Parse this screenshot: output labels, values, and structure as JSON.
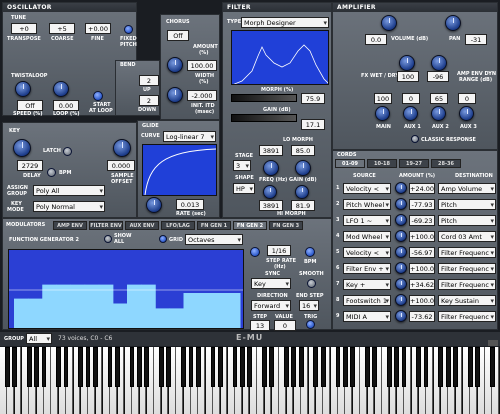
{
  "osc": {
    "title": "OSCILLATOR",
    "tune": "TUNE",
    "transpose": "+0",
    "coarse": "+5",
    "fine": "+0.00",
    "transpose_lbl": "TRANSPOSE",
    "coarse_lbl": "COARSE",
    "fine_lbl": "FINE",
    "fixed": "FIXED",
    "pitch": "PITCH",
    "twist": "TWISTALOOP",
    "speed": "Off",
    "loop": "0.00",
    "speed_lbl": "SPEED (%)",
    "loop_lbl": "LOOP (%)",
    "start": "START",
    "atloop": "AT LOOP"
  },
  "bend": {
    "title": "BEND",
    "up": "2",
    "up_lbl": "UP",
    "down": "2",
    "down_lbl": "DOWN"
  },
  "chorus": {
    "title": "CHORUS",
    "amount": "Off",
    "amount_lbl": "AMOUNT",
    "pct": "(%)",
    "width": "100.00",
    "width_lbl": "WIDTH",
    "width_unit": "(%)",
    "itd": "-2.000",
    "itd_lbl": "INIT. ITD",
    "itd_unit": "(msec)"
  },
  "key": {
    "title": "KEY",
    "latch": "LATCH",
    "delay": "2729",
    "delay_lbl": "DELAY",
    "bpm": "BPM",
    "offset": "0.000",
    "offset_lbl": "SAMPLE",
    "offset_lbl2": "OFFSET",
    "assign_lbl": "ASSIGN",
    "assign_lbl2": "GROUP",
    "assign": "Poly All",
    "mode_lbl": "KEY",
    "mode_lbl2": "MODE",
    "mode": "Poly Normal"
  },
  "glide": {
    "title": "GLIDE",
    "curve_lbl": "CURVE",
    "curve": "Log-linear 7",
    "rate": "0.013",
    "rate_lbl": "RATE (sec)"
  },
  "filter": {
    "title": "FILTER",
    "type_lbl": "TYPE",
    "type": "Morph Designer",
    "morph_lbl": "MORPH (%)",
    "morph": "75.9",
    "gain_lbl": "GAIN (dB)",
    "gain": "17.1",
    "lo_morph": "LO MORPH",
    "hi_morph": "HI MORPH",
    "stage_lbl": "STAGE",
    "stage": "3",
    "shape_lbl": "SHAPE",
    "shape": "HP",
    "f1": "3891",
    "g1": "85.0",
    "f2": "3891",
    "g2": "81.9",
    "freq_lbl": "FREQ (Hz)",
    "gain2_lbl": "GAIN (dB)"
  },
  "amp": {
    "title": "AMPLIFIER",
    "volume": "0.0",
    "volume_lbl": "VOLUME (dB)",
    "pan": "-31",
    "pan_lbl": "PAN",
    "fxwet_lbl": "FX WET / DRY",
    "fxwet": "100",
    "wet2": "-96",
    "dyn_lbl": "AMP ENV DYN",
    "dyn_lbl2": "RANGE (dB)",
    "main": "100",
    "aux1": "0",
    "aux2": "65",
    "aux3": "0",
    "main_lbl": "MAIN",
    "aux1_lbl": "AUX 1",
    "aux2_lbl": "AUX 2",
    "aux3_lbl": "AUX 3",
    "classic": "CLASSIC RESPONSE"
  },
  "cords": {
    "title": "CORDS",
    "tabs": [
      "01-09",
      "10-18",
      "19-27",
      "28-36"
    ],
    "src_hdr": "SOURCE",
    "amt_hdr": "AMOUNT (%)",
    "dst_hdr": "DESTINATION",
    "rows": [
      {
        "n": "1",
        "src": "Velocity <",
        "amt": "+24.00",
        "dst": "Amp Volume"
      },
      {
        "n": "2",
        "src": "Pitch Wheel",
        "amt": "-77.93",
        "dst": "Pitch"
      },
      {
        "n": "3",
        "src": "LFO 1 ~",
        "amt": "-69.23",
        "dst": "Pitch"
      },
      {
        "n": "4",
        "src": "Mod Wheel",
        "amt": "+100.0",
        "dst": "Cord 03 Amt"
      },
      {
        "n": "5",
        "src": "Velocity <",
        "amt": "-56.97",
        "dst": "Filter Frequenc"
      },
      {
        "n": "6",
        "src": "Filter Env +",
        "amt": "+100.0",
        "dst": "Filter Frequenc"
      },
      {
        "n": "7",
        "src": "Key +",
        "amt": "+34.62",
        "dst": "Filter Frequenc"
      },
      {
        "n": "8",
        "src": "Footswitch 1",
        "amt": "+100.0",
        "dst": "Key Sustain"
      },
      {
        "n": "9",
        "src": "MIDI A",
        "amt": "-73.62",
        "dst": "Filter Frequenc"
      }
    ]
  },
  "mod": {
    "title": "MODULATORS",
    "tabs": [
      "AMP ENV",
      "FILTER ENV",
      "AUX ENV",
      "LFO/LAG",
      "FN GEN 1",
      "FN GEN 2",
      "FN GEN 3"
    ],
    "fg_title": "FUNCTION GENERATOR 2",
    "show_all": "SHOW",
    "show_all2": "ALL",
    "grid_lbl": "GRID",
    "grid": "Octaves",
    "step_rate": "1/16",
    "step_rate_lbl": "STEP RATE",
    "step_rate_unit": "(Hz)",
    "bpm": "BPM",
    "sync_lbl": "SYNC",
    "smooth_lbl": "SMOOTH",
    "sync": "Key",
    "dir_lbl": "DIRECTION",
    "end_lbl": "END STEP",
    "dir": "Forward",
    "end": "16",
    "step_lbl": "STEP",
    "value_lbl": "VALUE",
    "trig_lbl": "TRIG",
    "step": "13",
    "value": "0",
    "steps": [
      0.42,
      0.42,
      0.62,
      0.62,
      0.62,
      0.62,
      0.62,
      0.35,
      0.62,
      0.62,
      0.28,
      0.28,
      0.5,
      0.5,
      0.5,
      0.5
    ]
  },
  "footer": {
    "group_lbl": "GROUP",
    "group": "All",
    "info": "73 voices, C0 - C6",
    "logo": "E-MU"
  }
}
